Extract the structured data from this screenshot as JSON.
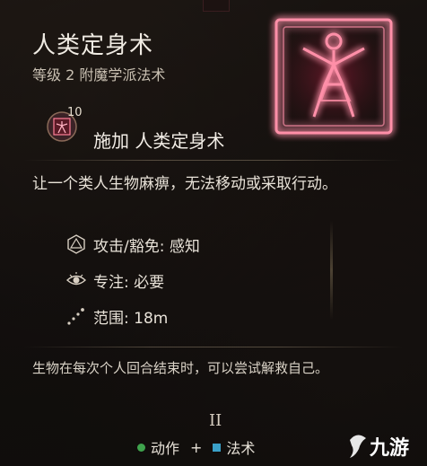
{
  "spell": {
    "name": "人类定身术",
    "subtitle": "等级 2 附魔学派法术",
    "icon": "humanoid-star-icon",
    "accent_color": "#ff5a78"
  },
  "cast": {
    "level": "10",
    "label": "施加 人类定身术"
  },
  "description": "让一个类人生物麻痹，无法移动或采取行动。",
  "properties": [
    {
      "icon": "d20-icon",
      "text": "攻击/豁免: 感知"
    },
    {
      "icon": "eye-icon",
      "text": "专注: 必要"
    },
    {
      "icon": "range-icon",
      "text": "范围: 18m"
    }
  ],
  "condition_text": "生物在每次个人回合结束时，可以尝试解救自己。",
  "footer": {
    "roman": "II",
    "action_label": "动作",
    "plus": "+",
    "slot_label": "法术",
    "action_color": "#3fa34d",
    "slot_color": "#3aa0c8"
  },
  "watermark": "九游"
}
